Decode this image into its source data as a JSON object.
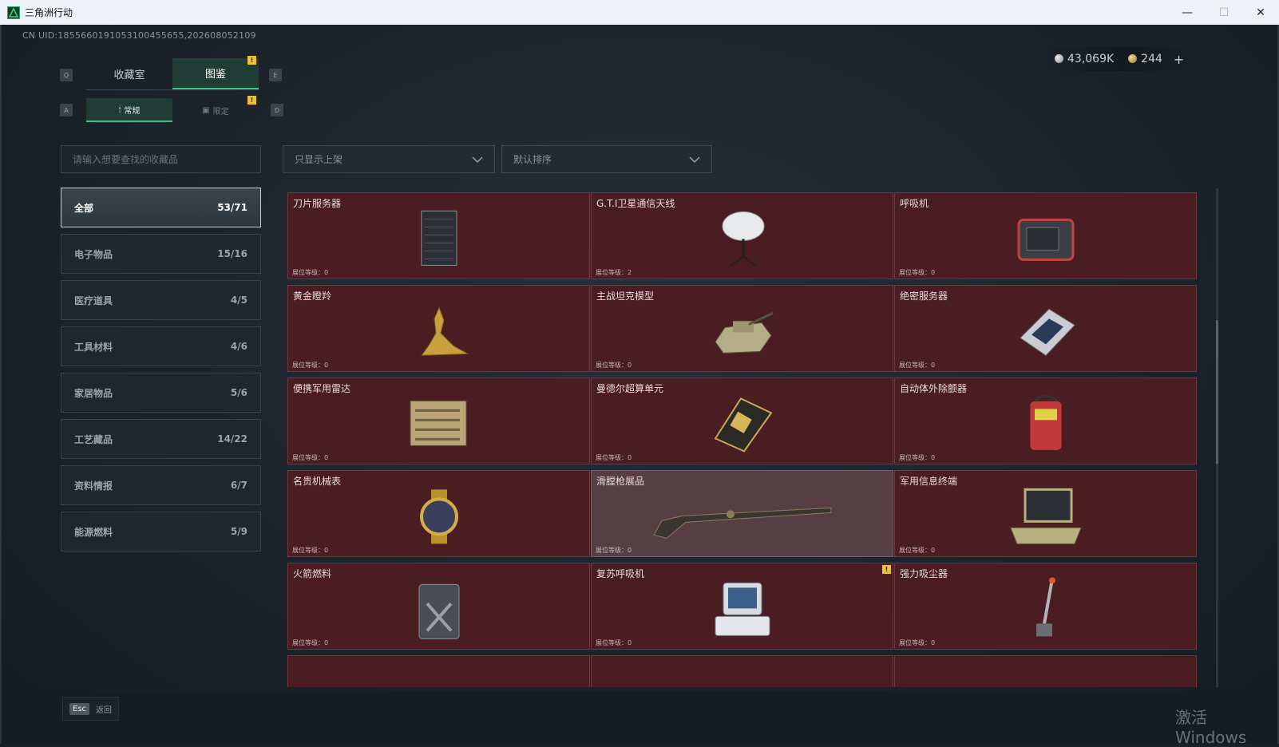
{
  "window": {
    "title": "三角洲行动",
    "minimize": "—",
    "maximize": "☐",
    "close": "✕"
  },
  "header": {
    "uid": "CN UID:1855660191053100455655,202608052109",
    "currency_silver": "43,069K",
    "currency_gold": "244",
    "add_label": "+"
  },
  "tabs": {
    "key_left": "Q",
    "key_right": "E",
    "items": [
      {
        "label": "收藏室"
      },
      {
        "label": "图鉴"
      }
    ]
  },
  "subtabs": {
    "key_left": "A",
    "key_right": "D",
    "items": [
      {
        "label": "常规"
      },
      {
        "label": "限定"
      }
    ]
  },
  "warn_mark": "!",
  "search": {
    "placeholder": "请输入想要查找的收藏品"
  },
  "filters": {
    "show_filter": "只显示上架",
    "sort": "默认排序"
  },
  "categories": [
    {
      "label": "全部",
      "count": "53/71"
    },
    {
      "label": "电子物品",
      "count": "15/16"
    },
    {
      "label": "医疗道具",
      "count": "4/5"
    },
    {
      "label": "工具材料",
      "count": "4/6"
    },
    {
      "label": "家居物品",
      "count": "5/6"
    },
    {
      "label": "工艺藏品",
      "count": "14/22"
    },
    {
      "label": "资料情报",
      "count": "6/7"
    },
    {
      "label": "能源燃料",
      "count": "5/9"
    }
  ],
  "items": [
    {
      "name": "刀片服务器",
      "level": "展位等级：0",
      "icon": "server-rack-icon"
    },
    {
      "name": "G.T.I卫星通信天线",
      "level": "展位等级：2",
      "icon": "satellite-dish-icon"
    },
    {
      "name": "呼吸机",
      "level": "展位等级：0",
      "icon": "ventilator-icon"
    },
    {
      "name": "黄金瞪羚",
      "level": "展位等级：0",
      "icon": "gold-gazelle-icon"
    },
    {
      "name": "主战坦克模型",
      "level": "展位等级：0",
      "icon": "tank-model-icon"
    },
    {
      "name": "绝密服务器",
      "level": "展位等级：0",
      "icon": "secret-server-icon"
    },
    {
      "name": "便携军用雷达",
      "level": "展位等级：0",
      "icon": "radar-icon"
    },
    {
      "name": "曼德尔超算单元",
      "level": "展位等级：0",
      "icon": "supercomputer-unit-icon"
    },
    {
      "name": "自动体外除颤器",
      "level": "展位等级：0",
      "icon": "defibrillator-icon"
    },
    {
      "name": "名贵机械表",
      "level": "展位等级：0",
      "icon": "watch-icon"
    },
    {
      "name": "滑膛枪展品",
      "level": "展位等级：0",
      "icon": "musket-icon"
    },
    {
      "name": "军用信息终端",
      "level": "展位等级：0",
      "icon": "military-terminal-icon"
    },
    {
      "name": "火箭燃料",
      "level": "展位等级：0",
      "icon": "fuel-can-icon"
    },
    {
      "name": "复苏呼吸机",
      "level": "展位等级：0",
      "icon": "resuscitator-icon"
    },
    {
      "name": "强力吸尘器",
      "level": "展位等级：0",
      "icon": "vacuum-cleaner-icon"
    }
  ],
  "footer": {
    "esc_key": "Esc",
    "esc_label": "返回"
  },
  "watermark": "激活 Windows",
  "colors": {
    "accent": "#39c28a",
    "card_bg": "#4a1d23",
    "warn": "#e9c23a"
  }
}
